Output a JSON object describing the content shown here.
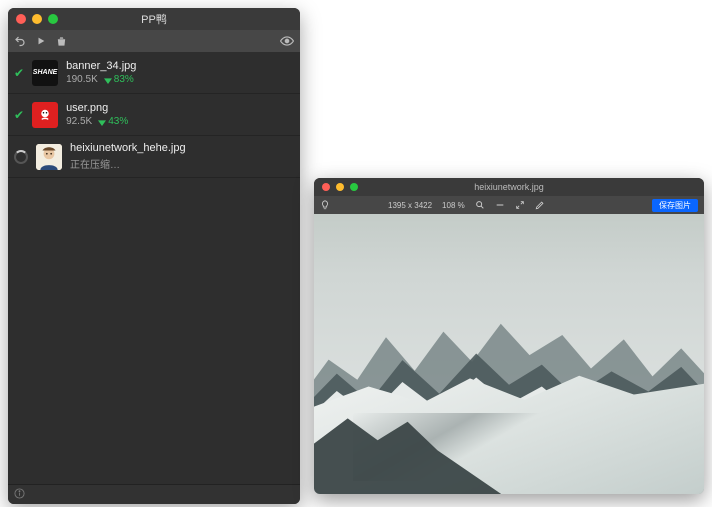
{
  "main": {
    "title": "PP鸭",
    "toolbar": {
      "undo": "undo",
      "play": "play",
      "trash": "trash",
      "visibility": "visibility"
    },
    "files": [
      {
        "status": "done",
        "thumb": "SHANE",
        "name": "banner_34.jpg",
        "size": "190.5K",
        "pct": "83%"
      },
      {
        "status": "done",
        "thumb": "user",
        "name": "user.png",
        "size": "92.5K",
        "pct": "43%"
      },
      {
        "status": "processing",
        "thumb": "face",
        "name": "heixiunetwork_hehe.jpg",
        "statusText": "正在压缩…"
      }
    ],
    "statusbar": {
      "info": "info"
    }
  },
  "preview": {
    "title": "heixiunetwork.jpg",
    "dims": "1395 x 3422",
    "zoom": "108 %",
    "button": "保存图片"
  }
}
